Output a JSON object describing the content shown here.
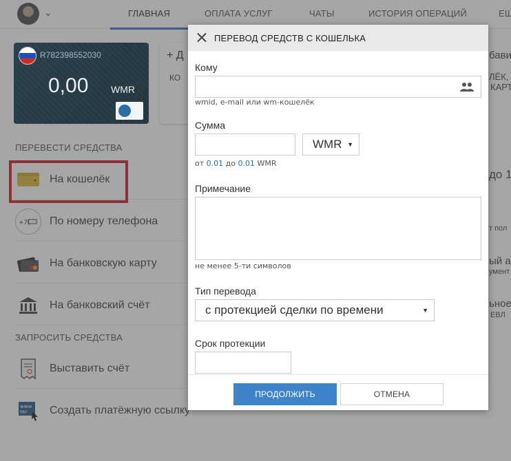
{
  "nav": {
    "tabs": [
      "ГЛАВНАЯ",
      "ОПЛАТА УСЛУГ",
      "ЧАТЫ",
      "ИСТОРИЯ ОПЕРАЦИЙ",
      "ЕЩ"
    ]
  },
  "wallet": {
    "id": "R782398552030",
    "balance": "0,00",
    "currency": "WMR"
  },
  "add_card": {
    "label": "+ Д",
    "sub": "КО"
  },
  "sidebar": {
    "transfer_heading": "ПЕРЕВЕСТИ СРЕДСТВА",
    "transfer_items": [
      {
        "label": "На кошелёк",
        "icon": "wallet-icon"
      },
      {
        "label": "По номеру телефона",
        "icon": "phone-icon"
      },
      {
        "label": "На банковскую карту",
        "icon": "bank-card-icon"
      },
      {
        "label": "На банковский счёт",
        "icon": "bank-icon"
      }
    ],
    "request_heading": "ЗАПРОСИТЬ СРЕДСТВА",
    "request_items": [
      {
        "label": "Выставить счёт",
        "icon": "invoice-icon"
      },
      {
        "label": "Создать платёжную ссылку",
        "icon": "payment-link-icon"
      }
    ]
  },
  "right_fragments": {
    "r1": "бави",
    "r2": "ЛЁК, К",
    "r3": "КАРТ",
    "r4": "до 1",
    "r5": "т пол",
    "r6": "ый а",
    "r7": "умент",
    "r8": "ьное",
    "r9": "ЕВЛ"
  },
  "modal": {
    "title": "ПЕРЕВОД СРЕДСТВ С КОШЕЛЬКА",
    "to_label": "Кому",
    "to_value": "",
    "to_hint": "wmid, e-mail или wm-кошелёк",
    "amount_label": "Сумма",
    "amount_value": "",
    "currency_selected": "WMR",
    "amount_hint_prefix": "от",
    "amount_min": "0.01",
    "amount_hint_mid": "до",
    "amount_max": "0.01",
    "amount_hint_currency": "WMR",
    "note_label": "Примечание",
    "note_value": "",
    "note_hint": "не менее 5-ти символов",
    "transfer_type_label": "Тип перевода",
    "transfer_type_selected": "с протекцией сделки по времени",
    "protection_label": "Срок протекции",
    "protection_value": "",
    "continue_button": "ПРОДОЛЖИТЬ",
    "cancel_button": "ОТМЕНА"
  },
  "colors": {
    "accent": "#3d85c8",
    "highlight": "#d11d2b",
    "link": "#1f6fb6"
  }
}
